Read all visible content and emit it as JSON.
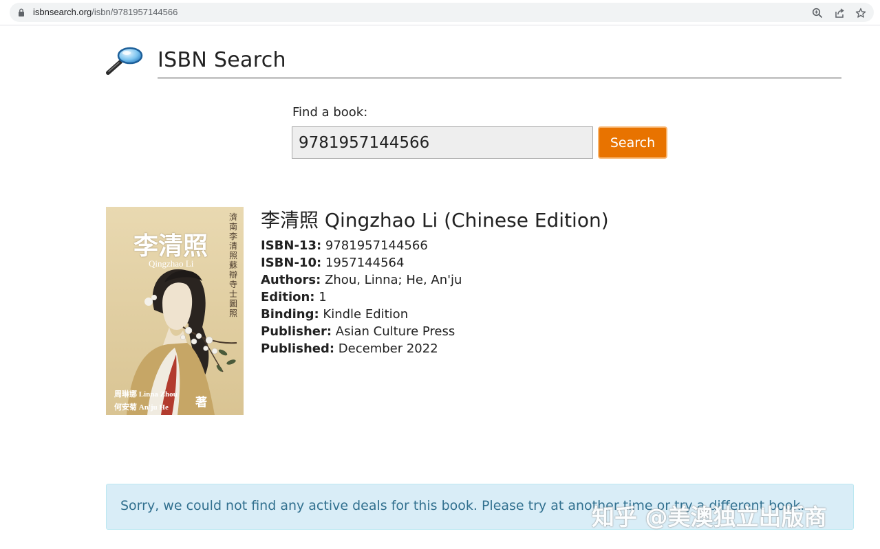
{
  "browser": {
    "url_domain": "isbnsearch.org",
    "url_path": "/isbn/9781957144566"
  },
  "header": {
    "title": "ISBN Search"
  },
  "search": {
    "label": "Find a book:",
    "value": "9781957144566",
    "button_label": "Search"
  },
  "book": {
    "title": "李清照 Qingzhao Li (Chinese Edition)",
    "cover": {
      "title_cn": "李清照",
      "title_en": "Qingzhao Li",
      "vertical_text": "濟南李清照蘇辯寺士圖照",
      "authors_line1": "周琳娜 Linna Zhou",
      "authors_line2": "何安菊 An'ju He",
      "zhu": "著"
    },
    "details": [
      {
        "key": "ISBN-13:",
        "value": "9781957144566"
      },
      {
        "key": "ISBN-10:",
        "value": "1957144564"
      },
      {
        "key": "Authors:",
        "value": "Zhou, Linna; He, An'ju"
      },
      {
        "key": "Edition:",
        "value": "1"
      },
      {
        "key": "Binding:",
        "value": "Kindle Edition"
      },
      {
        "key": "Publisher:",
        "value": "Asian Culture Press"
      },
      {
        "key": "Published:",
        "value": "December 2022"
      }
    ]
  },
  "alert": {
    "message": "Sorry, we could not find any active deals for this book. Please try at another time or try a different book."
  },
  "watermark": "知乎 @美澳独立出版商",
  "colors": {
    "accent": "#e87300",
    "alert_bg": "#d9edf7",
    "alert_text": "#31708f"
  },
  "icons": [
    "lock-icon",
    "zoom-icon",
    "share-icon",
    "star-icon",
    "magnifying-glass-logo-icon"
  ]
}
